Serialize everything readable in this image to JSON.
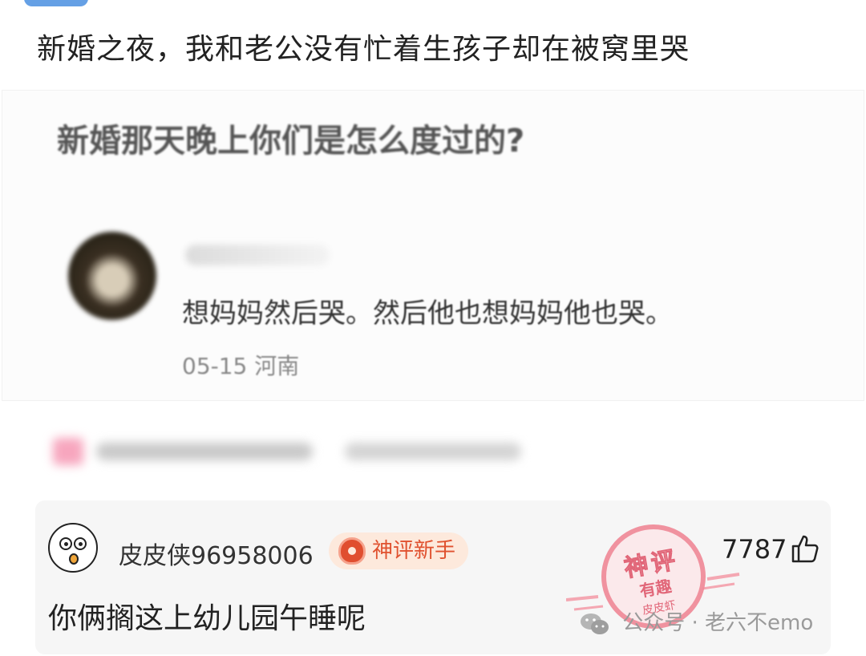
{
  "post": {
    "title": "新婚之夜，我和老公没有忙着生孩子却在被窝里哭"
  },
  "quoted_post": {
    "question": "新婚那天晚上你们是怎么度过的?",
    "comment": "想妈妈然后哭。然后他也想妈妈他也哭。",
    "date": "05-15",
    "location": "河南"
  },
  "comment": {
    "username": "皮皮侠96958006",
    "badge": "神评新手",
    "likes": "7787",
    "text": "你俩搁这上幼儿园午睡呢"
  },
  "stamp": {
    "line1": "神评",
    "line2": "有趣",
    "line3": "皮皮虾"
  },
  "watermark": {
    "text": "公众号 · 老六不emo"
  },
  "colors": {
    "badge_text": "#e0512f",
    "badge_bg": "#fde9dc",
    "stamp": "#f08a98",
    "card_bg": "#f6f6f6"
  },
  "icons": [
    "avatar-cartoon-icon",
    "badge-shield-icon",
    "thumb-up-icon",
    "wechat-icon"
  ]
}
